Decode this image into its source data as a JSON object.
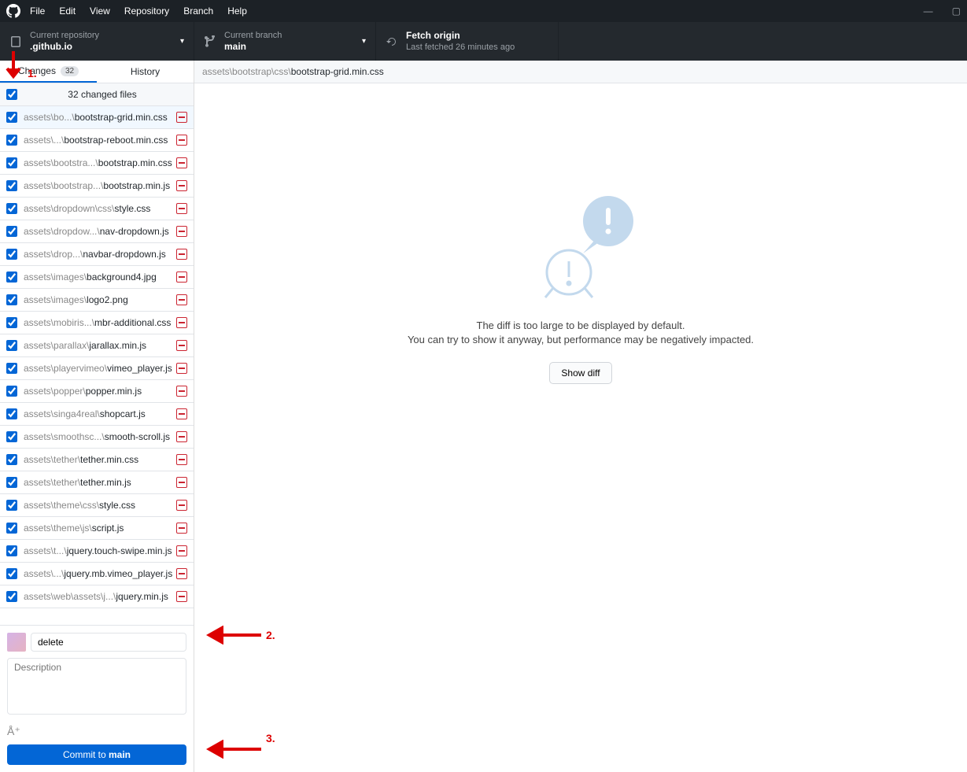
{
  "menu": [
    "File",
    "Edit",
    "View",
    "Repository",
    "Branch",
    "Help"
  ],
  "repo": {
    "label": "Current repository",
    "value": ".github.io"
  },
  "branch": {
    "label": "Current branch",
    "value": "main"
  },
  "fetch": {
    "label": "Fetch origin",
    "value": "Last fetched 26 minutes ago"
  },
  "tabs": {
    "changes": "Changes",
    "count": "32",
    "history": "History"
  },
  "headerFiles": "32 changed files",
  "files": [
    {
      "dir": "assets\\bo...\\",
      "name": "bootstrap-grid.min.css",
      "sel": true
    },
    {
      "dir": "assets\\...\\",
      "name": "bootstrap-reboot.min.css"
    },
    {
      "dir": "assets\\bootstra...\\",
      "name": "bootstrap.min.css"
    },
    {
      "dir": "assets\\bootstrap...\\",
      "name": "bootstrap.min.js"
    },
    {
      "dir": "assets\\dropdown\\css\\",
      "name": "style.css"
    },
    {
      "dir": "assets\\dropdow...\\",
      "name": "nav-dropdown.js"
    },
    {
      "dir": "assets\\drop...\\",
      "name": "navbar-dropdown.js"
    },
    {
      "dir": "assets\\images\\",
      "name": "background4.jpg"
    },
    {
      "dir": "assets\\images\\",
      "name": "logo2.png"
    },
    {
      "dir": "assets\\mobiris...\\",
      "name": "mbr-additional.css"
    },
    {
      "dir": "assets\\parallax\\",
      "name": "jarallax.min.js"
    },
    {
      "dir": "assets\\playervimeo\\",
      "name": "vimeo_player.js"
    },
    {
      "dir": "assets\\popper\\",
      "name": "popper.min.js"
    },
    {
      "dir": "assets\\singa4real\\",
      "name": "shopcart.js"
    },
    {
      "dir": "assets\\smoothsc...\\",
      "name": "smooth-scroll.js"
    },
    {
      "dir": "assets\\tether\\",
      "name": "tether.min.css"
    },
    {
      "dir": "assets\\tether\\",
      "name": "tether.min.js"
    },
    {
      "dir": "assets\\theme\\css\\",
      "name": "style.css"
    },
    {
      "dir": "assets\\theme\\js\\",
      "name": "script.js"
    },
    {
      "dir": "assets\\t...\\",
      "name": "jquery.touch-swipe.min.js"
    },
    {
      "dir": "assets\\...\\",
      "name": "jquery.mb.vimeo_player.js"
    },
    {
      "dir": "assets\\web\\assets\\j...\\",
      "name": "jquery.min.js"
    }
  ],
  "commit": {
    "summary": "delete",
    "descPlaceholder": "Description",
    "btnPre": "Commit to ",
    "btnBranch": "main"
  },
  "crumb": {
    "dir": "assets\\bootstrap\\css\\",
    "leaf": "bootstrap-grid.min.css"
  },
  "empty": {
    "l1": "The diff is too large to be displayed by default.",
    "l2": "You can try to show it anyway, but performance may be negatively impacted.",
    "btn": "Show diff"
  },
  "annots": {
    "a1": "1.",
    "a2": "2.",
    "a3": "3."
  }
}
